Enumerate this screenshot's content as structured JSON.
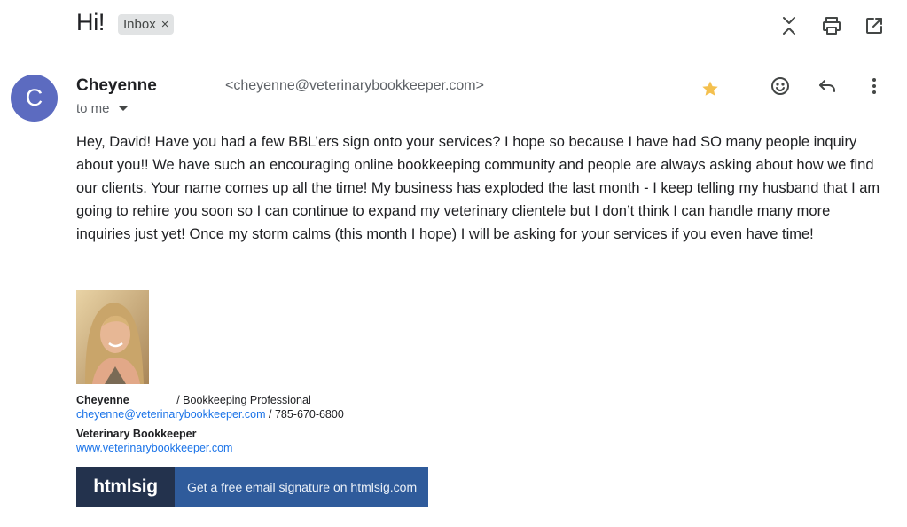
{
  "header": {
    "subject": "Hi!",
    "label": "Inbox",
    "label_remove": "×",
    "icons": [
      "expand-collapse-icon",
      "print-icon",
      "open-in-new-window-icon"
    ]
  },
  "message": {
    "avatar_letter": "C",
    "avatar_color": "#5c6bc0",
    "sender_name": "Cheyenne",
    "sender_email": "<cheyenne@veterinarybookkeeper.com>",
    "recipient": "to me",
    "starred": true,
    "star_color": "#f4c04e",
    "actions": [
      "emoji-react-icon",
      "reply-icon",
      "more-options-icon"
    ],
    "body": "Hey, David! Have you had a few BBL’ers sign onto your services? I hope so because I have had SO many people inquiry about you!! We have such an encouraging online bookkeeping community and people are always asking about how we find our clients. Your name comes up all the time! My business has exploded the last month - I keep telling my husband that I am going to rehire you soon so I can continue to expand my veterinary clientele but I don’t think I can handle many more inquiries just yet! Once my storm calms (this month I hope) I will be asking for your services if you even have time!"
  },
  "signature": {
    "name": "Cheyenne",
    "title": "/ Bookkeeping Professional",
    "email": "cheyenne@veterinarybookkeeper.com",
    "phone": "/ 785-670-6800",
    "company": "Veterinary Bookkeeper",
    "website": "www.veterinarybookkeeper.com",
    "banner_brand": "htmlsig",
    "banner_cta": "Get a free email signature on htmlsig.com",
    "link_color": "#1a73e8"
  }
}
